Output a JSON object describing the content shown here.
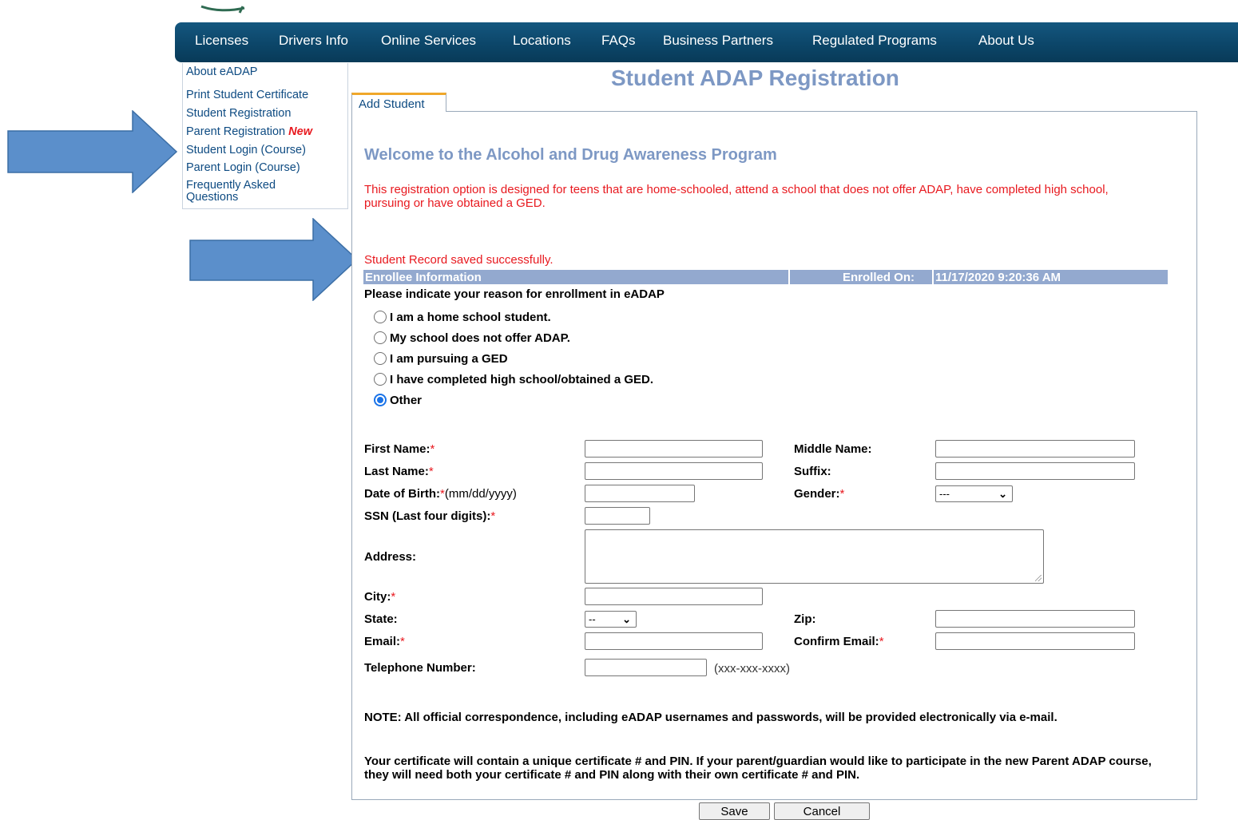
{
  "nav": {
    "items": [
      "Licenses",
      "Drivers Info",
      "Online Services",
      "Locations",
      "FAQs",
      "Business Partners",
      "Regulated Programs",
      "About Us"
    ]
  },
  "sidebar": {
    "items": [
      {
        "label": "About eADAP"
      },
      {
        "label": "Print Student Certificate"
      },
      {
        "label": "Student Registration"
      },
      {
        "label": "Parent Registration",
        "badge": "New"
      },
      {
        "label": "Student Login (Course)"
      },
      {
        "label": "Parent Login (Course)"
      },
      {
        "label": "Frequently Asked Questions"
      }
    ]
  },
  "page": {
    "title": "Student ADAP Registration",
    "tab": "Add Student",
    "welcome": "Welcome to the Alcohol and Drug Awareness Program",
    "intro": "This registration option is designed for teens that are home-schooled, attend a school that does not offer ADAP, have completed high school, pursuing or have obtained a GED.",
    "saved_message": "Student Record saved successfully."
  },
  "enrollee": {
    "section_label": "Enrollee Information",
    "enrolled_on_label": "Enrolled On:",
    "enrolled_on_value": "11/17/2020 9:20:36 AM",
    "reason_prompt": "Please indicate your reason for enrollment in eADAP",
    "reasons": [
      {
        "label": "I am a home school student.",
        "checked": false
      },
      {
        "label": "My school does not offer ADAP.",
        "checked": false
      },
      {
        "label": "I am pursuing a GED",
        "checked": false
      },
      {
        "label": "I have completed high school/obtained a GED.",
        "checked": false
      },
      {
        "label": "Other",
        "checked": true
      }
    ]
  },
  "form": {
    "first_name_label": "First Name:",
    "middle_name_label": "Middle Name:",
    "last_name_label": "Last Name:",
    "suffix_label": "Suffix:",
    "dob_label": "Date of Birth:",
    "dob_hint": "(mm/dd/yyyy)",
    "gender_label": "Gender:",
    "gender_value": "---",
    "ssn_label": "SSN (Last four digits):",
    "address_label": "Address:",
    "city_label": "City:",
    "state_label": "State:",
    "state_value": "--",
    "zip_label": "Zip:",
    "email_label": "Email:",
    "confirm_email_label": "Confirm Email:",
    "phone_label": "Telephone Number:",
    "phone_hint": "(xxx-xxx-xxxx)",
    "required_mark": "*",
    "values": {
      "first_name": "",
      "middle_name": "",
      "last_name": "",
      "suffix": "",
      "dob": "",
      "ssn": "",
      "address": "",
      "city": "",
      "zip": "",
      "email": "",
      "confirm_email": "",
      "phone": ""
    }
  },
  "notes": {
    "note1": "NOTE: All official correspondence, including eADAP usernames and passwords, will be provided electronically via e-mail.",
    "note2": "Your certificate will contain a unique certificate # and PIN. If your parent/guardian would like to participate in the new Parent ADAP course, they will need both your certificate # and PIN along with their own certificate # and PIN."
  },
  "buttons": {
    "save": "Save",
    "cancel": "Cancel"
  },
  "colors": {
    "nav_bg": "#0c4669",
    "title": "#7d98c4",
    "error_red": "#e8191f",
    "link_blue": "#0e4b82",
    "bar_bg": "#93a9cf",
    "arrow_blue": "#5b8fcb"
  },
  "icons": [
    "right-arrow-icon",
    "chevron-down-icon",
    "radio-icon"
  ]
}
